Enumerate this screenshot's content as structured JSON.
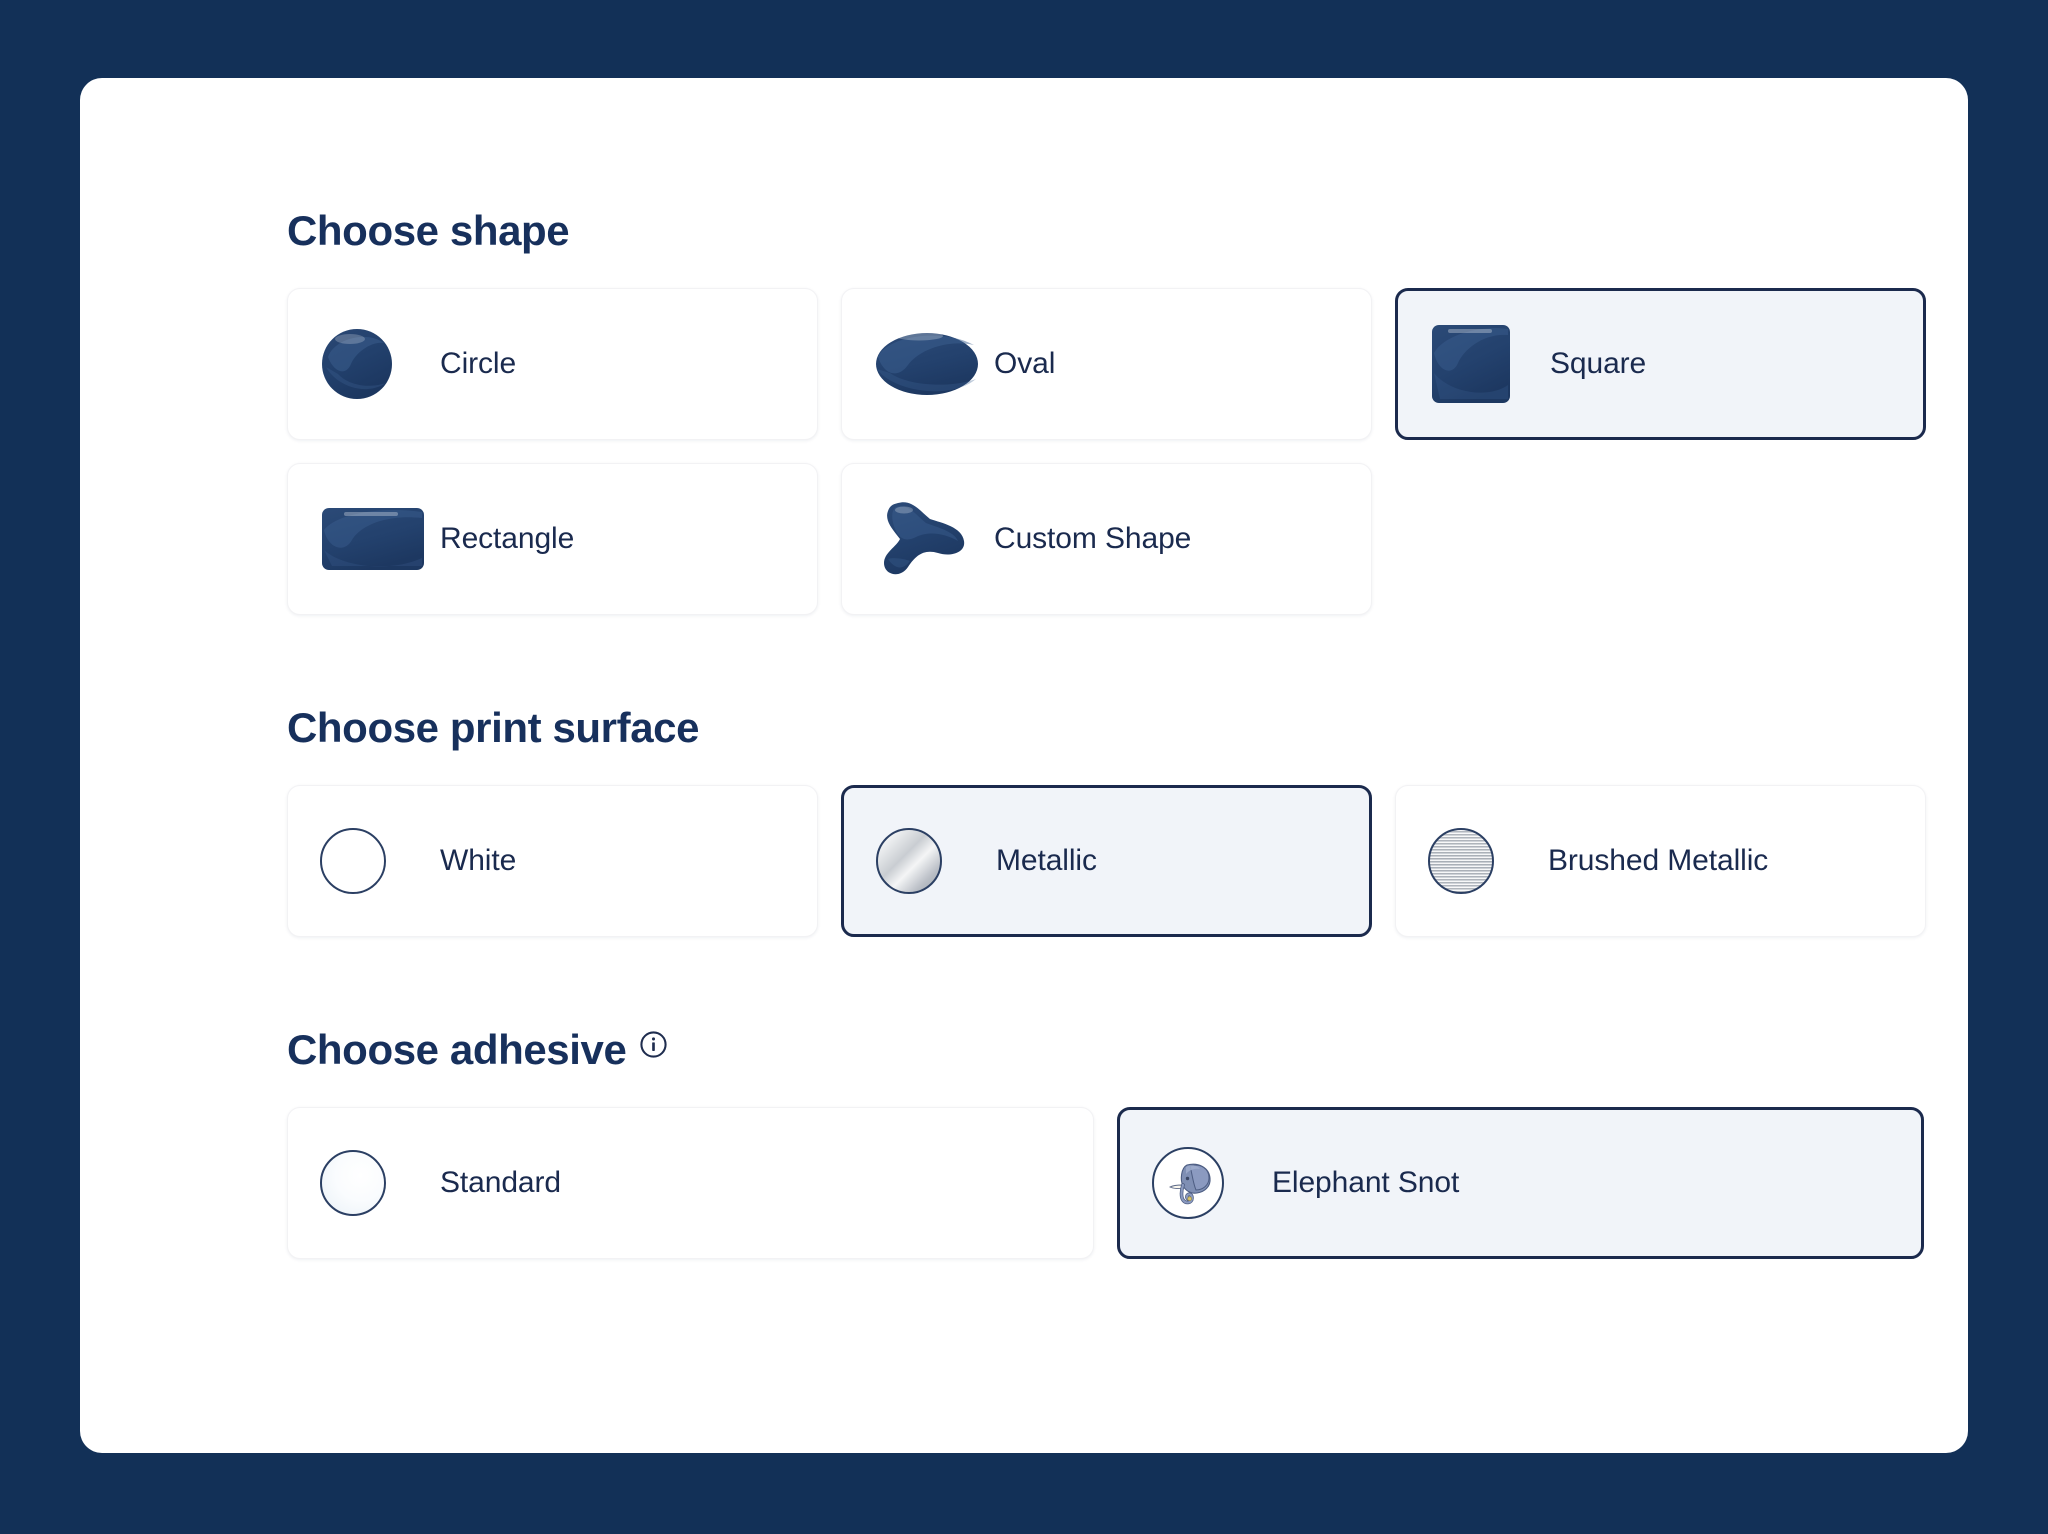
{
  "theme": {
    "page_background": "#123057",
    "card_background": "#ffffff",
    "text_primary": "#1a2a4e",
    "selected_border": "#1b2a4d",
    "selected_fill": "#f1f4f9",
    "swatch_outline": "#2b3f63"
  },
  "sections": {
    "shape": {
      "heading": "Choose shape",
      "options": [
        {
          "label": "Circle",
          "icon": "shape-circle-icon",
          "selected": false
        },
        {
          "label": "Oval",
          "icon": "shape-oval-icon",
          "selected": false
        },
        {
          "label": "Square",
          "icon": "shape-square-icon",
          "selected": true
        },
        {
          "label": "Rectangle",
          "icon": "shape-rectangle-icon",
          "selected": false
        },
        {
          "label": "Custom Shape",
          "icon": "shape-blob-icon",
          "selected": false
        }
      ]
    },
    "surface": {
      "heading": "Choose print surface",
      "options": [
        {
          "label": "White",
          "icon": "swatch-white-icon",
          "selected": false
        },
        {
          "label": "Metallic",
          "icon": "swatch-metallic-icon",
          "selected": true
        },
        {
          "label": "Brushed Metallic",
          "icon": "swatch-brushed-icon",
          "selected": false
        }
      ]
    },
    "adhesive": {
      "heading": "Choose adhesive",
      "info_icon": "info-circle-icon",
      "options": [
        {
          "label": "Standard",
          "icon": "swatch-standard-icon",
          "selected": false
        },
        {
          "label": "Elephant Snot",
          "icon": "elephant-head-icon",
          "selected": true
        }
      ]
    }
  }
}
